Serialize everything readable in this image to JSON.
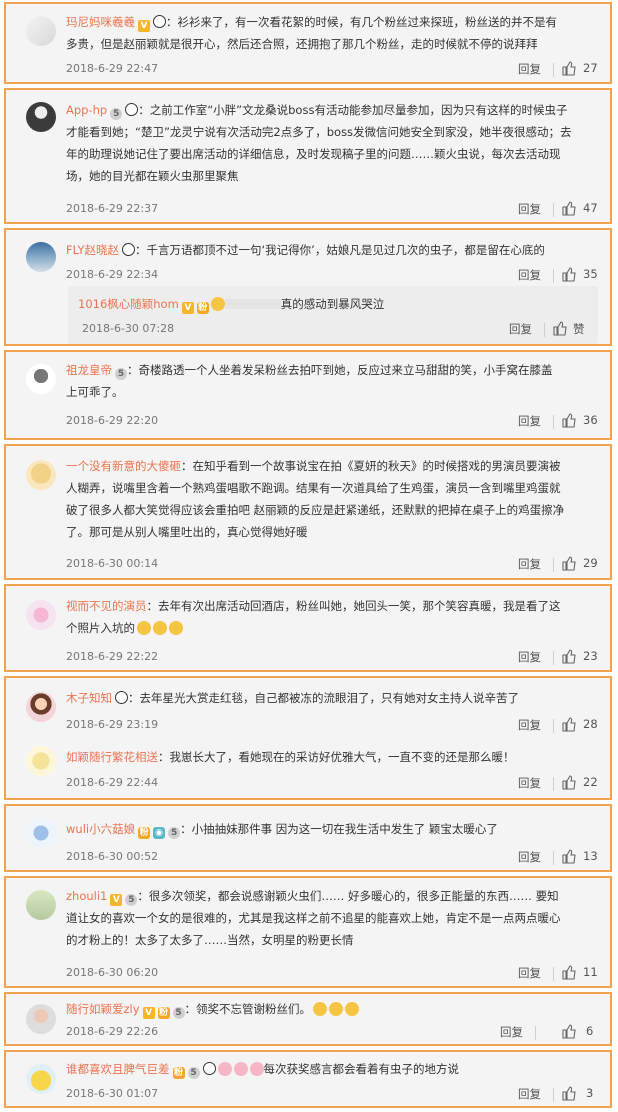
{
  "reply_label": "回复",
  "comments": [
    {
      "author": "玛尼妈咪羲羲",
      "lines": [
        "：衫衫来了，有一次看花絮的时候，有几个粉丝过来探班，粉丝送的并不是有",
        "多贵，但是赵丽颖就是很开心，然后还合照，还拥抱了那几个粉丝，走的时候就不停的说拜拜"
      ],
      "time": "2018-6-29 22:47",
      "likes": "27"
    },
    {
      "author": "App-hp",
      "lines": [
        "：之前工作室“小胖”文龙桑说boss有活动能参加尽量参加，因为只有这样的时候虫子",
        "才能看到她；“楚卫”龙灵宁说有次活动完2点多了，boss发微信问她安全到家没，她半夜很感动；去",
        "年的助理说她记住了要出席活动的详细信息，及时发现稿子里的问题……颖火虫说，每次去活动现",
        "场，她的目光都在颖火虫那里聚焦"
      ],
      "time": "2018-6-29 22:37",
      "likes": "47"
    },
    {
      "author": "FLY赵晓赵",
      "lines": [
        "：千言万语都顶不过一句‘我记得你’，姑娘凡是见过几次的虫子，都是留在心底的"
      ],
      "time": "2018-6-29 22:34",
      "likes": "35",
      "subreply": {
        "author": "1016枫心随颖hom",
        "text": "真的感动到暴风哭泣",
        "time": "2018-6-30 07:28",
        "likes": "赞"
      }
    },
    {
      "author": "祖龙皇帝",
      "lines": [
        "：奇楼路透一个人坐着发呆粉丝去拍吓到她，反应过来立马甜甜的笑，小手窝在膝盖",
        "上可乖了。"
      ],
      "time": "2018-6-29 22:20",
      "likes": "36"
    },
    {
      "author": "一个没有新意的大傻砸",
      "lines": [
        "：在知乎看到一个故事说宝在拍《夏妍的秋天》的时候搭戏的男演员要演被",
        "人糊弄，说嘴里含着一个熟鸡蛋唱歌不跑调。结果有一次道具给了生鸡蛋，演员一含到嘴里鸡蛋就",
        "破了很多人都大笑觉得应该会重拍吧 赵丽颖的反应是赶紧递纸，还默默的把掉在桌子上的鸡蛋擦净",
        "了。那可是从别人嘴里吐出的，真心觉得她好暖"
      ],
      "time": "2018-6-30 00:14",
      "likes": "29"
    },
    {
      "author": "视而不见的演员",
      "lines": [
        "：去年有次出席活动回酒店，粉丝叫她，她回头一笑，那个笑容真暖，我是看了这",
        "个照片入坑的"
      ],
      "time": "2018-6-29 22:22",
      "likes": "23"
    },
    {
      "author": "木子知知",
      "lines": [
        "：去年星光大赏走红毯，自己都被冻的流眼泪了，只有她对女主持人说辛苦了"
      ],
      "time": "2018-6-29 23:19",
      "likes": "28"
    },
    {
      "author": "如颖随行繁花相送",
      "lines": [
        "：我崽长大了，看她现在的采访好优雅大气，一直不变的还是那么暖！"
      ],
      "time": "2018-6-29 22:44",
      "likes": "22"
    },
    {
      "author": "wuli小六菇娘",
      "lines": [
        "：小抽抽妹那件事 因为这一切在我生活中发生了 颖宝太暖心了"
      ],
      "time": "2018-6-30 00:52",
      "likes": "13"
    },
    {
      "author": "zhouli1",
      "lines": [
        "：很多次领奖，都会说感谢颖火虫们…… 好多暖心的，很多正能量的东西…… 要知",
        "道让女的喜欢一个女的是很难的，尤其是我这样之前不追星的能喜欢上她，肯定不是一点两点暖心",
        "的才粉上的！太多了太多了……当然，女明星的粉更长情"
      ],
      "time": "2018-6-30 06:20",
      "likes": "11"
    },
    {
      "author": "随行如颖爱zly",
      "lines": [
        "：领奖不忘管谢粉丝们。"
      ],
      "time": "2018-6-29 22:26",
      "likes": "6"
    },
    {
      "author": "谁都喜欢且脾气巨差",
      "lines": [
        "每次获奖感言都会看着有虫子的地方说"
      ],
      "time": "2018-6-30 01:07",
      "likes": "3"
    }
  ]
}
